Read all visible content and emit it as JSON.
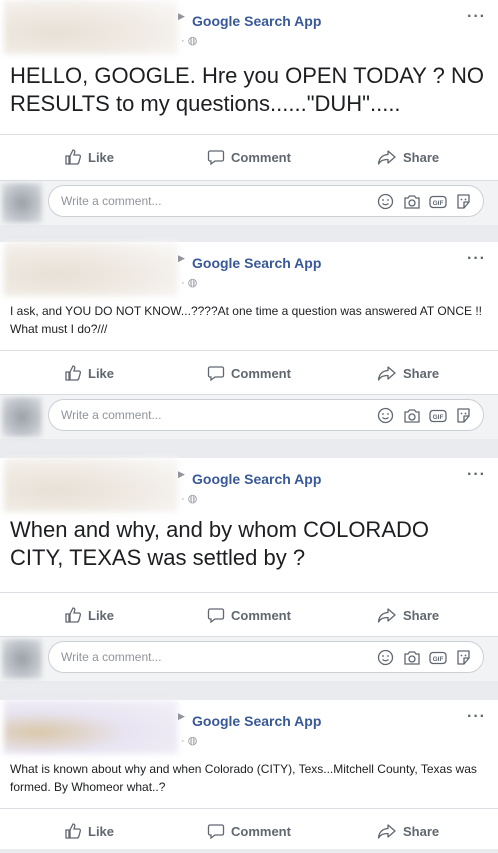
{
  "posts": [
    {
      "page_name": "Google Search App",
      "text": "HELLO, GOOGLE. Hre you OPEN TODAY ?  NO RESULTS to my questions......\"DUH\".....",
      "text_size": "big"
    },
    {
      "page_name": "Google Search App",
      "text": "I ask, and YOU DO NOT KNOW...????At one time a question was answered AT ONCE !! What must I do?///",
      "text_size": "small"
    },
    {
      "page_name": "Google Search App",
      "text": "When and why, and by whom COLORADO CITY, TEXAS was settled by ?",
      "text_size": "big"
    },
    {
      "page_name": "Google Search App",
      "text": "What is known about why and when Colorado (CITY), Texs...Mitchell County, Texas was formed. By Whomeor what..?",
      "text_size": "small"
    }
  ],
  "actions": {
    "like": "Like",
    "comment": "Comment",
    "share": "Share"
  },
  "comment_box": {
    "placeholder": "Write a comment..."
  },
  "icons": {
    "more": "more-options-icon",
    "privacy": "globe-icon",
    "like": "thumbs-up-icon",
    "comment": "speech-bubble-icon",
    "share": "share-arrow-icon",
    "emoji": "smiley-icon",
    "camera": "camera-icon",
    "gif": "gif-icon",
    "sticker": "sticker-icon"
  },
  "colors": {
    "page_name": "#385898",
    "action_text": "#606770",
    "placeholder": "#90949c",
    "feed_bg": "#e9ebee"
  }
}
